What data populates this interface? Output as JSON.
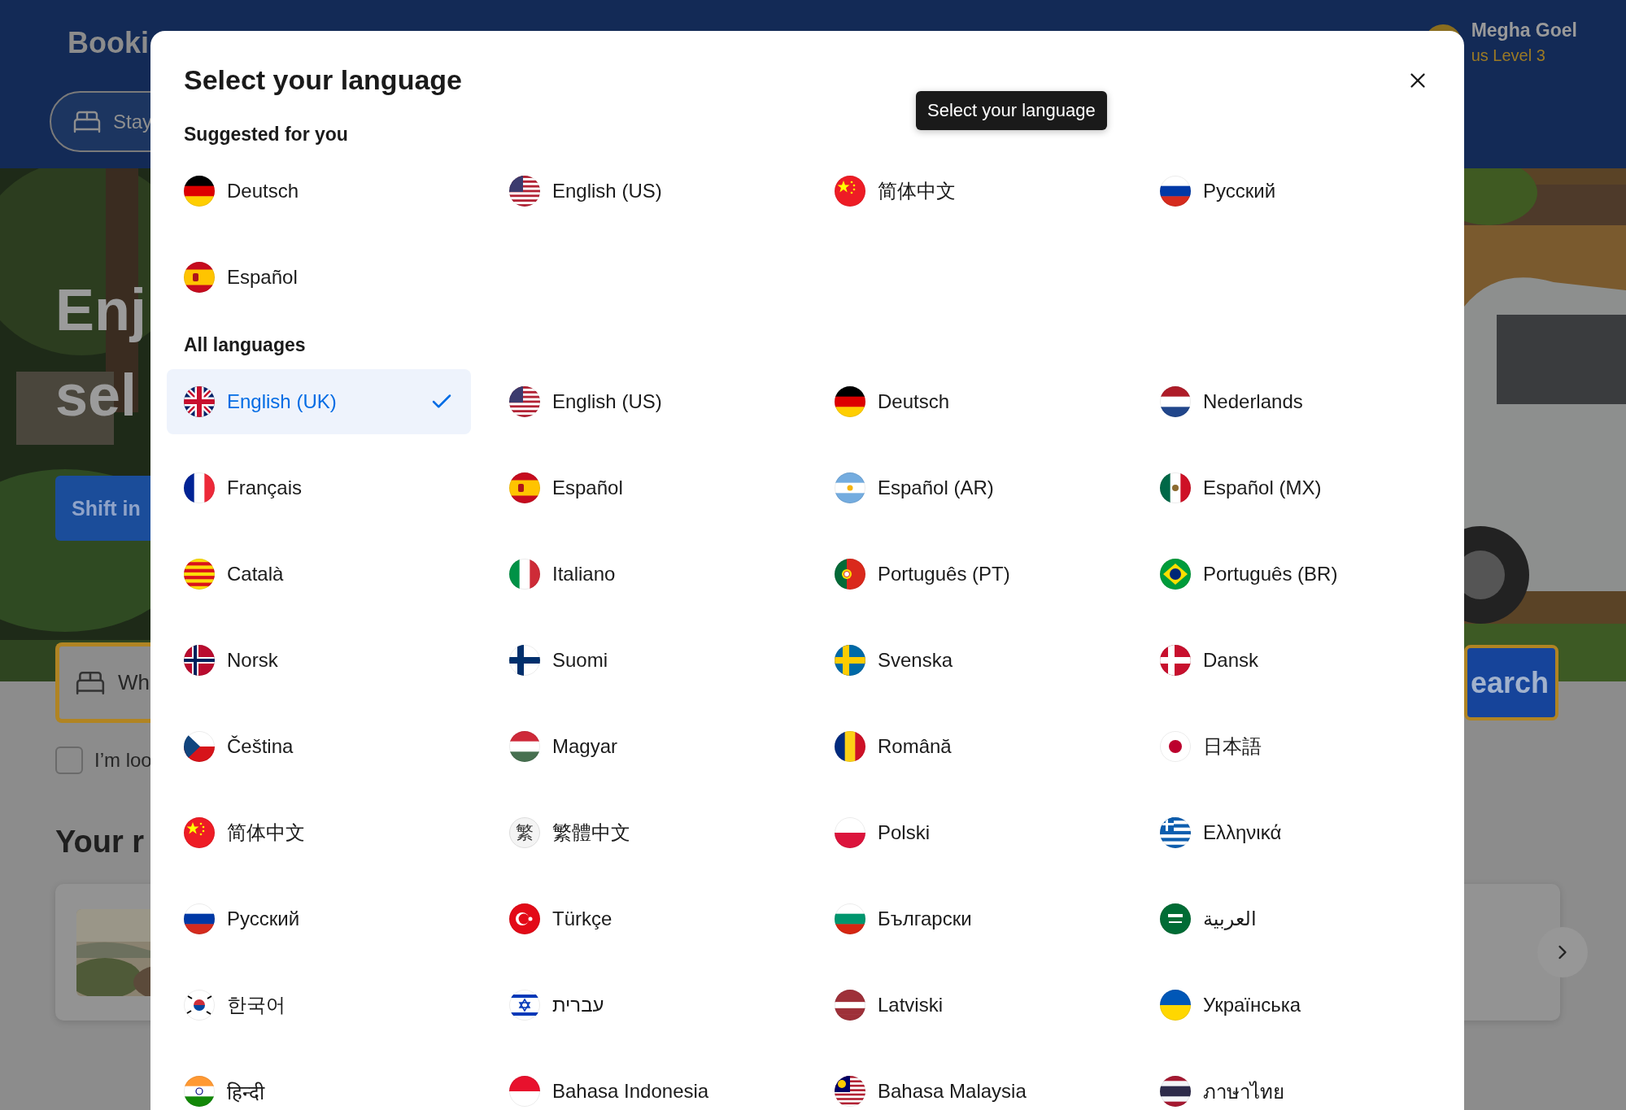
{
  "background": {
    "logo": "Booki",
    "nav_tab": "Stay",
    "user": {
      "name": "Megha Goel",
      "level": "us Level 3"
    },
    "hero": {
      "headline": [
        "Enj",
        "sel"
      ],
      "button": "Shift in"
    },
    "search": {
      "placeholder": "Wh",
      "button": "earch"
    },
    "checkbox": {
      "label": "I’m loo",
      "checked": false
    },
    "section_title": "Your r"
  },
  "dialog": {
    "title": "Select your language",
    "tooltip": "Select your language",
    "sections": [
      {
        "heading": "Suggested for you",
        "languages": [
          {
            "label": "Deutsch",
            "kind": "germany",
            "selected": false
          },
          {
            "label": "English (US)",
            "kind": "usa",
            "selected": false
          },
          {
            "label": "简体中文",
            "kind": "china",
            "selected": false
          },
          {
            "label": "Русский",
            "kind": "russia",
            "selected": false
          },
          {
            "label": "Español",
            "kind": "spain",
            "selected": false
          }
        ]
      },
      {
        "heading": "All languages",
        "languages": [
          {
            "label": "English (UK)",
            "kind": "uk",
            "selected": true
          },
          {
            "label": "English (US)",
            "kind": "usa",
            "selected": false
          },
          {
            "label": "Deutsch",
            "kind": "germany",
            "selected": false
          },
          {
            "label": "Nederlands",
            "kind": "netherlands",
            "selected": false
          },
          {
            "label": "Français",
            "kind": "france",
            "selected": false
          },
          {
            "label": "Español",
            "kind": "spain",
            "selected": false
          },
          {
            "label": "Español (AR)",
            "kind": "argentina",
            "selected": false
          },
          {
            "label": "Español (MX)",
            "kind": "mexico",
            "selected": false
          },
          {
            "label": "Català",
            "kind": "catalonia",
            "selected": false
          },
          {
            "label": "Italiano",
            "kind": "italy",
            "selected": false
          },
          {
            "label": "Português (PT)",
            "kind": "portugal",
            "selected": false
          },
          {
            "label": "Português (BR)",
            "kind": "brazil",
            "selected": false
          },
          {
            "label": "Norsk",
            "kind": "norway",
            "selected": false
          },
          {
            "label": "Suomi",
            "kind": "finland",
            "selected": false
          },
          {
            "label": "Svenska",
            "kind": "sweden",
            "selected": false
          },
          {
            "label": "Dansk",
            "kind": "denmark",
            "selected": false
          },
          {
            "label": "Čeština",
            "kind": "czechia",
            "selected": false
          },
          {
            "label": "Magyar",
            "kind": "hungary",
            "selected": false
          },
          {
            "label": "Română",
            "kind": "romania",
            "selected": false
          },
          {
            "label": "日本語",
            "kind": "japan",
            "selected": false
          },
          {
            "label": "简体中文",
            "kind": "china",
            "selected": false
          },
          {
            "label": "繁體中文",
            "kind": "glyph",
            "icon": "繁",
            "selected": false
          },
          {
            "label": "Polski",
            "kind": "poland",
            "selected": false
          },
          {
            "label": "Ελληνικά",
            "kind": "greece",
            "selected": false
          },
          {
            "label": "Русский",
            "kind": "russia",
            "selected": false
          },
          {
            "label": "Türkçe",
            "kind": "turkey",
            "selected": false
          },
          {
            "label": "Български",
            "kind": "bulgaria",
            "selected": false
          },
          {
            "label": "العربية",
            "kind": "saudi",
            "selected": false
          },
          {
            "label": "한국어",
            "kind": "korea",
            "selected": false
          },
          {
            "label": "עברית",
            "kind": "israel",
            "selected": false
          },
          {
            "label": "Latviski",
            "kind": "latvia",
            "selected": false
          },
          {
            "label": "Українська",
            "kind": "ukraine",
            "selected": false
          },
          {
            "label": "हिन्दी",
            "kind": "india",
            "selected": false
          },
          {
            "label": "Bahasa Indonesia",
            "kind": "indonesia",
            "selected": false
          },
          {
            "label": "Bahasa Malaysia",
            "kind": "malaysia",
            "selected": false
          },
          {
            "label": "ภาษาไทย",
            "kind": "thailand",
            "selected": false
          }
        ]
      }
    ]
  }
}
